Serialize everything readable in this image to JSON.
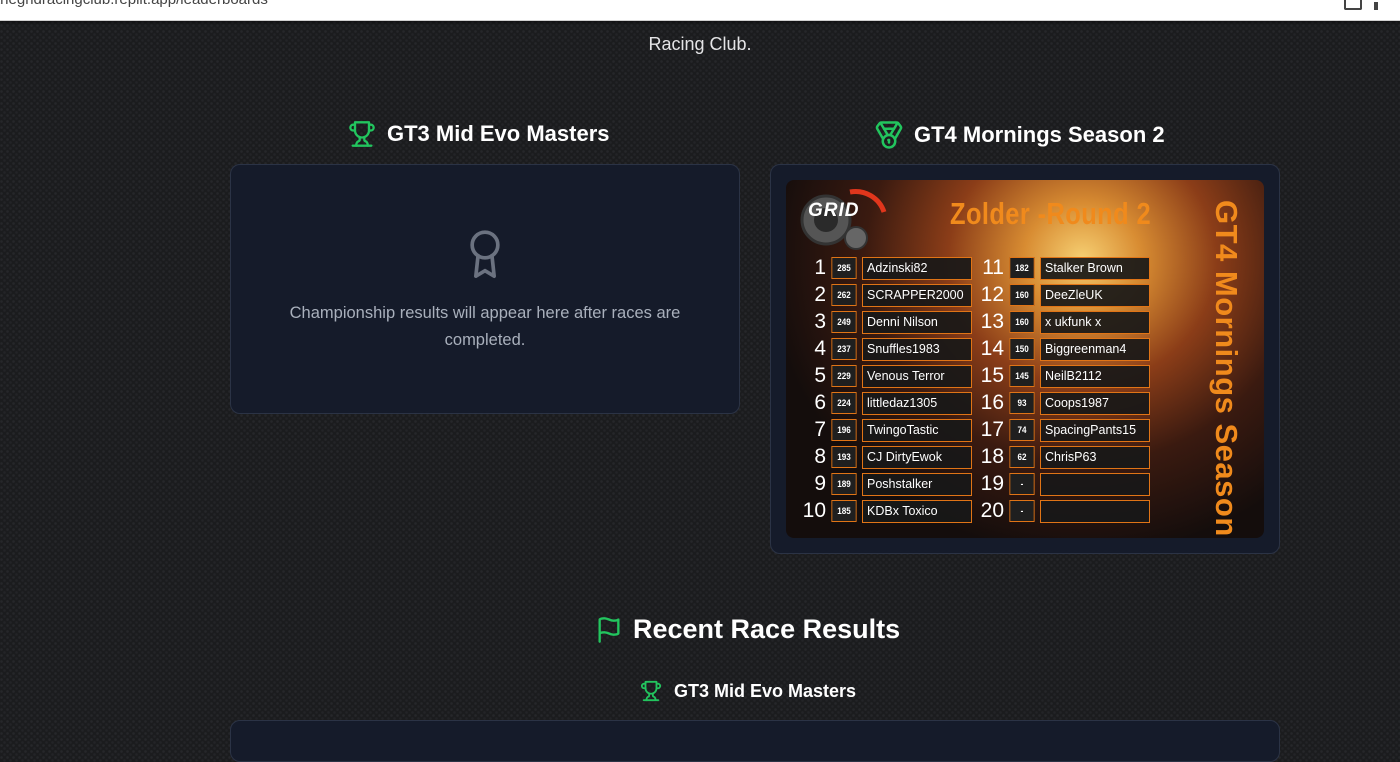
{
  "browser": {
    "url": "thegridracingclub.replit.app/leaderboards"
  },
  "header": {
    "subtitle": "Racing Club."
  },
  "championships": [
    {
      "title": "GT3 Mid Evo Masters",
      "icon": "trophy-icon",
      "empty_message": "Championship results will appear here after races are completed.",
      "empty_icon": "award-icon"
    },
    {
      "title": "GT4 Mornings Season 2",
      "icon": "medal-icon"
    }
  ],
  "leaderboard_image": {
    "logo": "GRID",
    "round": "Zolder -Round 2",
    "season": "GT4 Mornings Season 2",
    "rows": [
      {
        "pos": "1",
        "pts": "285",
        "name": "Adzinski82"
      },
      {
        "pos": "2",
        "pts": "262",
        "name": "SCRAPPER2000"
      },
      {
        "pos": "3",
        "pts": "249",
        "name": "Denni Nilson"
      },
      {
        "pos": "4",
        "pts": "237",
        "name": "Snuffles1983"
      },
      {
        "pos": "5",
        "pts": "229",
        "name": "Venous Terror"
      },
      {
        "pos": "6",
        "pts": "224",
        "name": "littledaz1305"
      },
      {
        "pos": "7",
        "pts": "196",
        "name": "TwingoTastic"
      },
      {
        "pos": "8",
        "pts": "193",
        "name": "CJ DirtyEwok"
      },
      {
        "pos": "9",
        "pts": "189",
        "name": "Poshstalker"
      },
      {
        "pos": "10",
        "pts": "185",
        "name": "KDBx Toxico"
      },
      {
        "pos": "11",
        "pts": "182",
        "name": "Stalker Brown"
      },
      {
        "pos": "12",
        "pts": "160",
        "name": "DeeZleUK"
      },
      {
        "pos": "13",
        "pts": "160",
        "name": "x ukfunk x"
      },
      {
        "pos": "14",
        "pts": "150",
        "name": "Biggreenman4"
      },
      {
        "pos": "15",
        "pts": "145",
        "name": "NeilB2112"
      },
      {
        "pos": "16",
        "pts": "93",
        "name": "Coops1987"
      },
      {
        "pos": "17",
        "pts": "74",
        "name": "SpacingPants15"
      },
      {
        "pos": "18",
        "pts": "62",
        "name": "ChrisP63"
      },
      {
        "pos": "19",
        "pts": "-",
        "name": ""
      },
      {
        "pos": "20",
        "pts": "-",
        "name": ""
      }
    ]
  },
  "recent": {
    "title": "Recent Race Results",
    "icon": "flag-icon",
    "sub_title": "GT3 Mid Evo Masters",
    "sub_icon": "trophy-icon"
  },
  "colors": {
    "accent_green": "#22c55e",
    "card_bg": "#151b2a",
    "orange": "#f08a1c"
  }
}
